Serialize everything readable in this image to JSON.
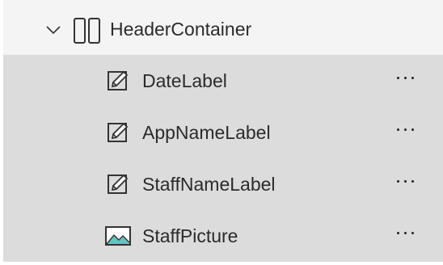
{
  "tree": {
    "header": {
      "label": "HeaderContainer",
      "expand_icon": "chevron-down-icon",
      "type_icon": "container-icon"
    },
    "children": [
      {
        "label": "DateLabel",
        "icon": "edit-label-icon",
        "more": "more-options-icon"
      },
      {
        "label": "AppNameLabel",
        "icon": "edit-label-icon",
        "more": "more-options-icon"
      },
      {
        "label": "StaffNameLabel",
        "icon": "edit-label-icon",
        "more": "more-options-icon"
      },
      {
        "label": "StaffPicture",
        "icon": "image-icon",
        "more": "more-options-icon"
      }
    ]
  },
  "colors": {
    "panel": "#f4f4f4",
    "selected_group": "#dcdcdc",
    "text": "#2b2b2b",
    "image_accent": "#5fc7c1"
  }
}
